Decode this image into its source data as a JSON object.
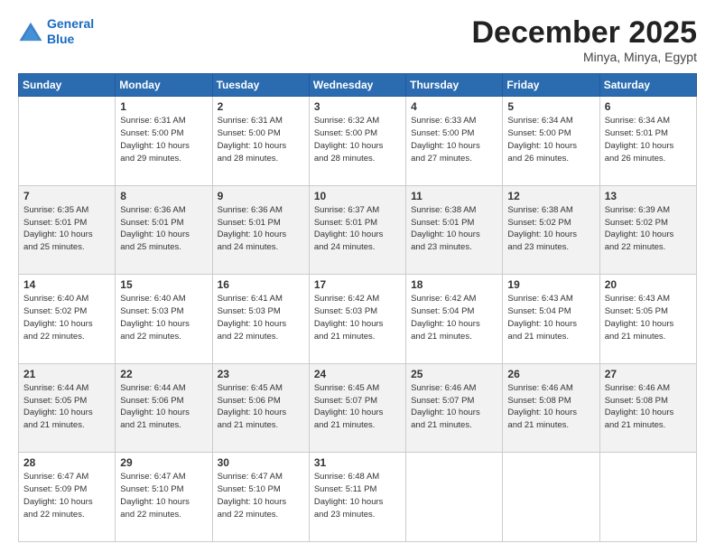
{
  "logo": {
    "line1": "General",
    "line2": "Blue"
  },
  "title": "December 2025",
  "subtitle": "Minya, Minya, Egypt",
  "weekdays": [
    "Sunday",
    "Monday",
    "Tuesday",
    "Wednesday",
    "Thursday",
    "Friday",
    "Saturday"
  ],
  "weeks": [
    [
      {
        "day": "",
        "info": ""
      },
      {
        "day": "1",
        "info": "Sunrise: 6:31 AM\nSunset: 5:00 PM\nDaylight: 10 hours\nand 29 minutes."
      },
      {
        "day": "2",
        "info": "Sunrise: 6:31 AM\nSunset: 5:00 PM\nDaylight: 10 hours\nand 28 minutes."
      },
      {
        "day": "3",
        "info": "Sunrise: 6:32 AM\nSunset: 5:00 PM\nDaylight: 10 hours\nand 28 minutes."
      },
      {
        "day": "4",
        "info": "Sunrise: 6:33 AM\nSunset: 5:00 PM\nDaylight: 10 hours\nand 27 minutes."
      },
      {
        "day": "5",
        "info": "Sunrise: 6:34 AM\nSunset: 5:00 PM\nDaylight: 10 hours\nand 26 minutes."
      },
      {
        "day": "6",
        "info": "Sunrise: 6:34 AM\nSunset: 5:01 PM\nDaylight: 10 hours\nand 26 minutes."
      }
    ],
    [
      {
        "day": "7",
        "info": "Sunrise: 6:35 AM\nSunset: 5:01 PM\nDaylight: 10 hours\nand 25 minutes."
      },
      {
        "day": "8",
        "info": "Sunrise: 6:36 AM\nSunset: 5:01 PM\nDaylight: 10 hours\nand 25 minutes."
      },
      {
        "day": "9",
        "info": "Sunrise: 6:36 AM\nSunset: 5:01 PM\nDaylight: 10 hours\nand 24 minutes."
      },
      {
        "day": "10",
        "info": "Sunrise: 6:37 AM\nSunset: 5:01 PM\nDaylight: 10 hours\nand 24 minutes."
      },
      {
        "day": "11",
        "info": "Sunrise: 6:38 AM\nSunset: 5:01 PM\nDaylight: 10 hours\nand 23 minutes."
      },
      {
        "day": "12",
        "info": "Sunrise: 6:38 AM\nSunset: 5:02 PM\nDaylight: 10 hours\nand 23 minutes."
      },
      {
        "day": "13",
        "info": "Sunrise: 6:39 AM\nSunset: 5:02 PM\nDaylight: 10 hours\nand 22 minutes."
      }
    ],
    [
      {
        "day": "14",
        "info": "Sunrise: 6:40 AM\nSunset: 5:02 PM\nDaylight: 10 hours\nand 22 minutes."
      },
      {
        "day": "15",
        "info": "Sunrise: 6:40 AM\nSunset: 5:03 PM\nDaylight: 10 hours\nand 22 minutes."
      },
      {
        "day": "16",
        "info": "Sunrise: 6:41 AM\nSunset: 5:03 PM\nDaylight: 10 hours\nand 22 minutes."
      },
      {
        "day": "17",
        "info": "Sunrise: 6:42 AM\nSunset: 5:03 PM\nDaylight: 10 hours\nand 21 minutes."
      },
      {
        "day": "18",
        "info": "Sunrise: 6:42 AM\nSunset: 5:04 PM\nDaylight: 10 hours\nand 21 minutes."
      },
      {
        "day": "19",
        "info": "Sunrise: 6:43 AM\nSunset: 5:04 PM\nDaylight: 10 hours\nand 21 minutes."
      },
      {
        "day": "20",
        "info": "Sunrise: 6:43 AM\nSunset: 5:05 PM\nDaylight: 10 hours\nand 21 minutes."
      }
    ],
    [
      {
        "day": "21",
        "info": "Sunrise: 6:44 AM\nSunset: 5:05 PM\nDaylight: 10 hours\nand 21 minutes."
      },
      {
        "day": "22",
        "info": "Sunrise: 6:44 AM\nSunset: 5:06 PM\nDaylight: 10 hours\nand 21 minutes."
      },
      {
        "day": "23",
        "info": "Sunrise: 6:45 AM\nSunset: 5:06 PM\nDaylight: 10 hours\nand 21 minutes."
      },
      {
        "day": "24",
        "info": "Sunrise: 6:45 AM\nSunset: 5:07 PM\nDaylight: 10 hours\nand 21 minutes."
      },
      {
        "day": "25",
        "info": "Sunrise: 6:46 AM\nSunset: 5:07 PM\nDaylight: 10 hours\nand 21 minutes."
      },
      {
        "day": "26",
        "info": "Sunrise: 6:46 AM\nSunset: 5:08 PM\nDaylight: 10 hours\nand 21 minutes."
      },
      {
        "day": "27",
        "info": "Sunrise: 6:46 AM\nSunset: 5:08 PM\nDaylight: 10 hours\nand 21 minutes."
      }
    ],
    [
      {
        "day": "28",
        "info": "Sunrise: 6:47 AM\nSunset: 5:09 PM\nDaylight: 10 hours\nand 22 minutes."
      },
      {
        "day": "29",
        "info": "Sunrise: 6:47 AM\nSunset: 5:10 PM\nDaylight: 10 hours\nand 22 minutes."
      },
      {
        "day": "30",
        "info": "Sunrise: 6:47 AM\nSunset: 5:10 PM\nDaylight: 10 hours\nand 22 minutes."
      },
      {
        "day": "31",
        "info": "Sunrise: 6:48 AM\nSunset: 5:11 PM\nDaylight: 10 hours\nand 23 minutes."
      },
      {
        "day": "",
        "info": ""
      },
      {
        "day": "",
        "info": ""
      },
      {
        "day": "",
        "info": ""
      }
    ]
  ]
}
